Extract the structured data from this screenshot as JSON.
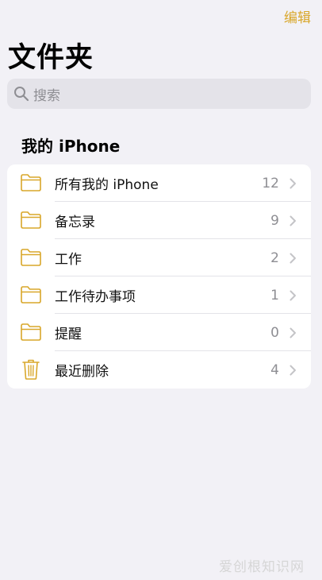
{
  "header": {
    "edit_label": "编辑",
    "title": "文件夹"
  },
  "search": {
    "placeholder": "搜索",
    "icon": "magnifying-glass-icon"
  },
  "section": {
    "title": "我的 iPhone"
  },
  "folders": [
    {
      "label": "所有我的 iPhone",
      "count": "12",
      "icon": "folder-icon"
    },
    {
      "label": "备忘录",
      "count": "9",
      "icon": "folder-icon"
    },
    {
      "label": "工作",
      "count": "2",
      "icon": "folder-icon"
    },
    {
      "label": "工作待办事项",
      "count": "1",
      "icon": "folder-icon"
    },
    {
      "label": "提醒",
      "count": "0",
      "icon": "folder-icon"
    },
    {
      "label": "最近删除",
      "count": "4",
      "icon": "trash-icon"
    }
  ],
  "watermark": {
    "text": "爱创根知识网"
  },
  "colors": {
    "accent": "#d9a72a",
    "background": "#f2f1f6",
    "card": "#ffffff",
    "secondary_text": "#8e8e93"
  }
}
